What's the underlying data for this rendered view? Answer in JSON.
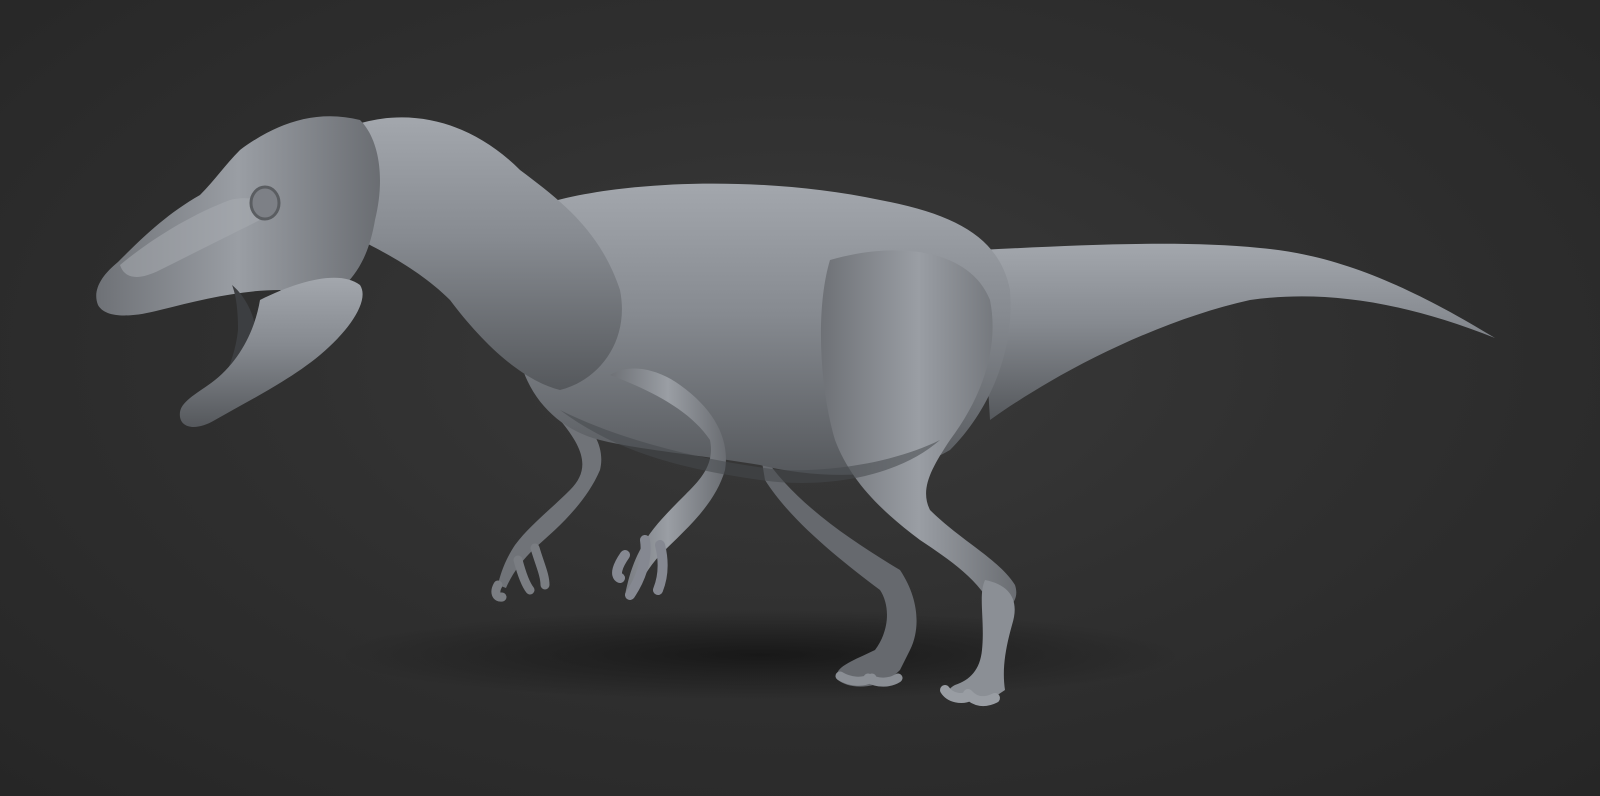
{
  "scene": {
    "subject_icon": "dinosaur-sculpt-icon",
    "colors": {
      "background_center": "#3a3a3a",
      "background_edge": "#262626",
      "clay_base": "#7c7f84",
      "clay_light": "#a3a7ad",
      "clay_dark": "#4a4c50",
      "shadow": "#1c1c1c"
    }
  }
}
